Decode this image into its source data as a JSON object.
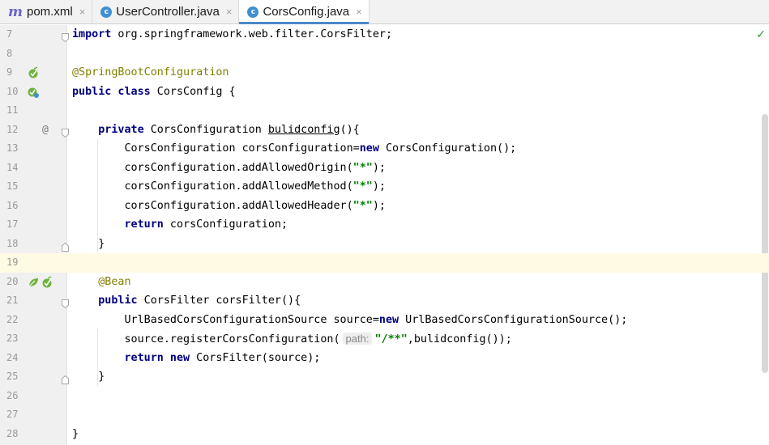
{
  "tabs": [
    {
      "icon": "maven-m-icon",
      "glyph": "m",
      "label": "pom.xml",
      "active": false
    },
    {
      "icon": "java-class-icon",
      "glyph": "c",
      "label": "UserController.java",
      "active": false
    },
    {
      "icon": "java-class-icon",
      "glyph": "c",
      "label": "CorsConfig.java",
      "active": true
    }
  ],
  "tab_close_glyph": "×",
  "colors": {
    "keyword": "#000080",
    "annotation": "#808000",
    "string": "#008000",
    "accent": "#4a88c7",
    "current_line": "#fffae3"
  },
  "status_check": "✓",
  "code_lines": [
    {
      "n": "7",
      "segs": [
        [
          "kw",
          "import"
        ],
        [
          "t",
          " org.springframework.web.filter.CorsFilter;"
        ]
      ]
    },
    {
      "n": "8",
      "segs": []
    },
    {
      "n": "9",
      "segs": [
        [
          "ann",
          "@SpringBootConfiguration"
        ]
      ]
    },
    {
      "n": "10",
      "segs": [
        [
          "kw",
          "public class"
        ],
        [
          "t",
          " CorsConfig {"
        ]
      ]
    },
    {
      "n": "11",
      "segs": []
    },
    {
      "n": "12",
      "segs": [
        [
          "t",
          "    "
        ],
        [
          "kw",
          "private"
        ],
        [
          "t",
          " CorsConfiguration "
        ],
        [
          "u",
          "bulidconfig"
        ],
        [
          "t",
          "(){"
        ]
      ]
    },
    {
      "n": "13",
      "segs": [
        [
          "t",
          "        CorsConfiguration corsConfiguration="
        ],
        [
          "kw",
          "new"
        ],
        [
          "t",
          " CorsConfiguration();"
        ]
      ]
    },
    {
      "n": "14",
      "segs": [
        [
          "t",
          "        corsConfiguration.addAllowedOrigin("
        ],
        [
          "str",
          "\"*\""
        ],
        [
          "t",
          ");"
        ]
      ]
    },
    {
      "n": "15",
      "segs": [
        [
          "t",
          "        corsConfiguration.addAllowedMethod("
        ],
        [
          "str",
          "\"*\""
        ],
        [
          "t",
          ");"
        ]
      ]
    },
    {
      "n": "16",
      "segs": [
        [
          "t",
          "        corsConfiguration.addAllowedHeader("
        ],
        [
          "str",
          "\"*\""
        ],
        [
          "t",
          ");"
        ]
      ]
    },
    {
      "n": "17",
      "segs": [
        [
          "t",
          "        "
        ],
        [
          "kw",
          "return"
        ],
        [
          "t",
          " corsConfiguration;"
        ]
      ]
    },
    {
      "n": "18",
      "segs": [
        [
          "t",
          "    }"
        ]
      ]
    },
    {
      "n": "19",
      "segs": []
    },
    {
      "n": "20",
      "segs": [
        [
          "t",
          "    "
        ],
        [
          "ann",
          "@Bean"
        ]
      ]
    },
    {
      "n": "21",
      "segs": [
        [
          "t",
          "    "
        ],
        [
          "kw",
          "public"
        ],
        [
          "t",
          " CorsFilter corsFilter(){"
        ]
      ]
    },
    {
      "n": "22",
      "segs": [
        [
          "t",
          "        UrlBasedCorsConfigurationSource source="
        ],
        [
          "kw",
          "new"
        ],
        [
          "t",
          " UrlBasedCorsConfigurationSource();"
        ]
      ]
    },
    {
      "n": "23",
      "segs": [
        [
          "t",
          "        source.registerCorsConfiguration("
        ],
        [
          "hint",
          "path:"
        ],
        [
          "str",
          "\"/**\""
        ],
        [
          "t",
          ",bulidconfig());"
        ]
      ]
    },
    {
      "n": "24",
      "segs": [
        [
          "t",
          "        "
        ],
        [
          "kw",
          "return new"
        ],
        [
          "t",
          " CorsFilter(source);"
        ]
      ]
    },
    {
      "n": "25",
      "segs": [
        [
          "t",
          "    }"
        ]
      ]
    },
    {
      "n": "26",
      "segs": []
    },
    {
      "n": "27",
      "segs": []
    },
    {
      "n": "28",
      "segs": [
        [
          "t",
          "}"
        ]
      ]
    }
  ],
  "current_line": "19",
  "gutter_marks": {
    "9": [
      "spring-bean-icon"
    ],
    "10": [
      "spring-config-icon"
    ],
    "12": [
      "at-sign"
    ],
    "20": [
      "spring-gutter-icon",
      "spring-bean-icon"
    ]
  },
  "at_glyph": "@",
  "folds": {
    "7": "fold-open",
    "12": "fold-open",
    "18": "fold-close",
    "21": "fold-open",
    "25": "fold-close"
  }
}
